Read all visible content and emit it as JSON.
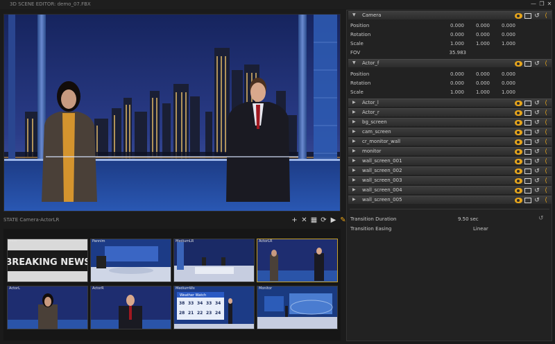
{
  "window": {
    "title": "3D SCENE EDITOR: demo_07.FBX",
    "buttons": [
      "—",
      "❐",
      "✕"
    ]
  },
  "state": {
    "label": "STATE Camera-ActorLR"
  },
  "toolbar": {
    "tools": [
      "add",
      "delete",
      "grid",
      "refresh",
      "play",
      "edit"
    ]
  },
  "thumbnails": [
    {
      "label": "Intro",
      "headline": "BREAKING NEWS"
    },
    {
      "label": "Pannim"
    },
    {
      "label": "MediumLR"
    },
    {
      "label": "ActorLR",
      "selected": true
    },
    {
      "label": "ActorL"
    },
    {
      "label": "ActorR"
    },
    {
      "label": "MediumWx",
      "weather_title": "Weather Watch",
      "temps_hi": [
        "38",
        "33",
        "34",
        "33",
        "34"
      ],
      "temps_lo": [
        "28",
        "21",
        "22",
        "23",
        "24"
      ]
    },
    {
      "label": "Monitor"
    }
  ],
  "panel": {
    "camera": {
      "name": "Camera",
      "props": [
        {
          "label": "Position",
          "values": [
            "0.000",
            "0.000",
            "0.000"
          ]
        },
        {
          "label": "Rotation",
          "values": [
            "0.000",
            "0.000",
            "0.000"
          ]
        },
        {
          "label": "Scale",
          "values": [
            "1.000",
            "1.000",
            "1.000"
          ]
        },
        {
          "label": "FOV",
          "values": [
            "35.983"
          ]
        }
      ]
    },
    "actor_f": {
      "name": "Actor_f",
      "props": [
        {
          "label": "Position",
          "values": [
            "0.000",
            "0.000",
            "0.000"
          ]
        },
        {
          "label": "Rotation",
          "values": [
            "0.000",
            "0.000",
            "0.000"
          ]
        },
        {
          "label": "Scale",
          "values": [
            "1.000",
            "1.000",
            "1.000"
          ]
        }
      ]
    },
    "objects": [
      "Actor_l",
      "Actor_r",
      "bg_screen",
      "cam_screen",
      "cr_monitor_wall",
      "monitor",
      "wall_screen_001",
      "wall_screen_002",
      "wall_screen_003",
      "wall_screen_004",
      "wall_screen_005"
    ],
    "transition": {
      "duration_label": "Transition Duration",
      "duration_value": "9.50 sec",
      "easing_label": "Transition Easing",
      "easing_value": "Linear"
    }
  },
  "colors": {
    "accent": "#e6a51c",
    "sky_top": "#1a2a6a",
    "sky_bottom": "#3a4f9a",
    "floor": "#2a4f9e"
  }
}
